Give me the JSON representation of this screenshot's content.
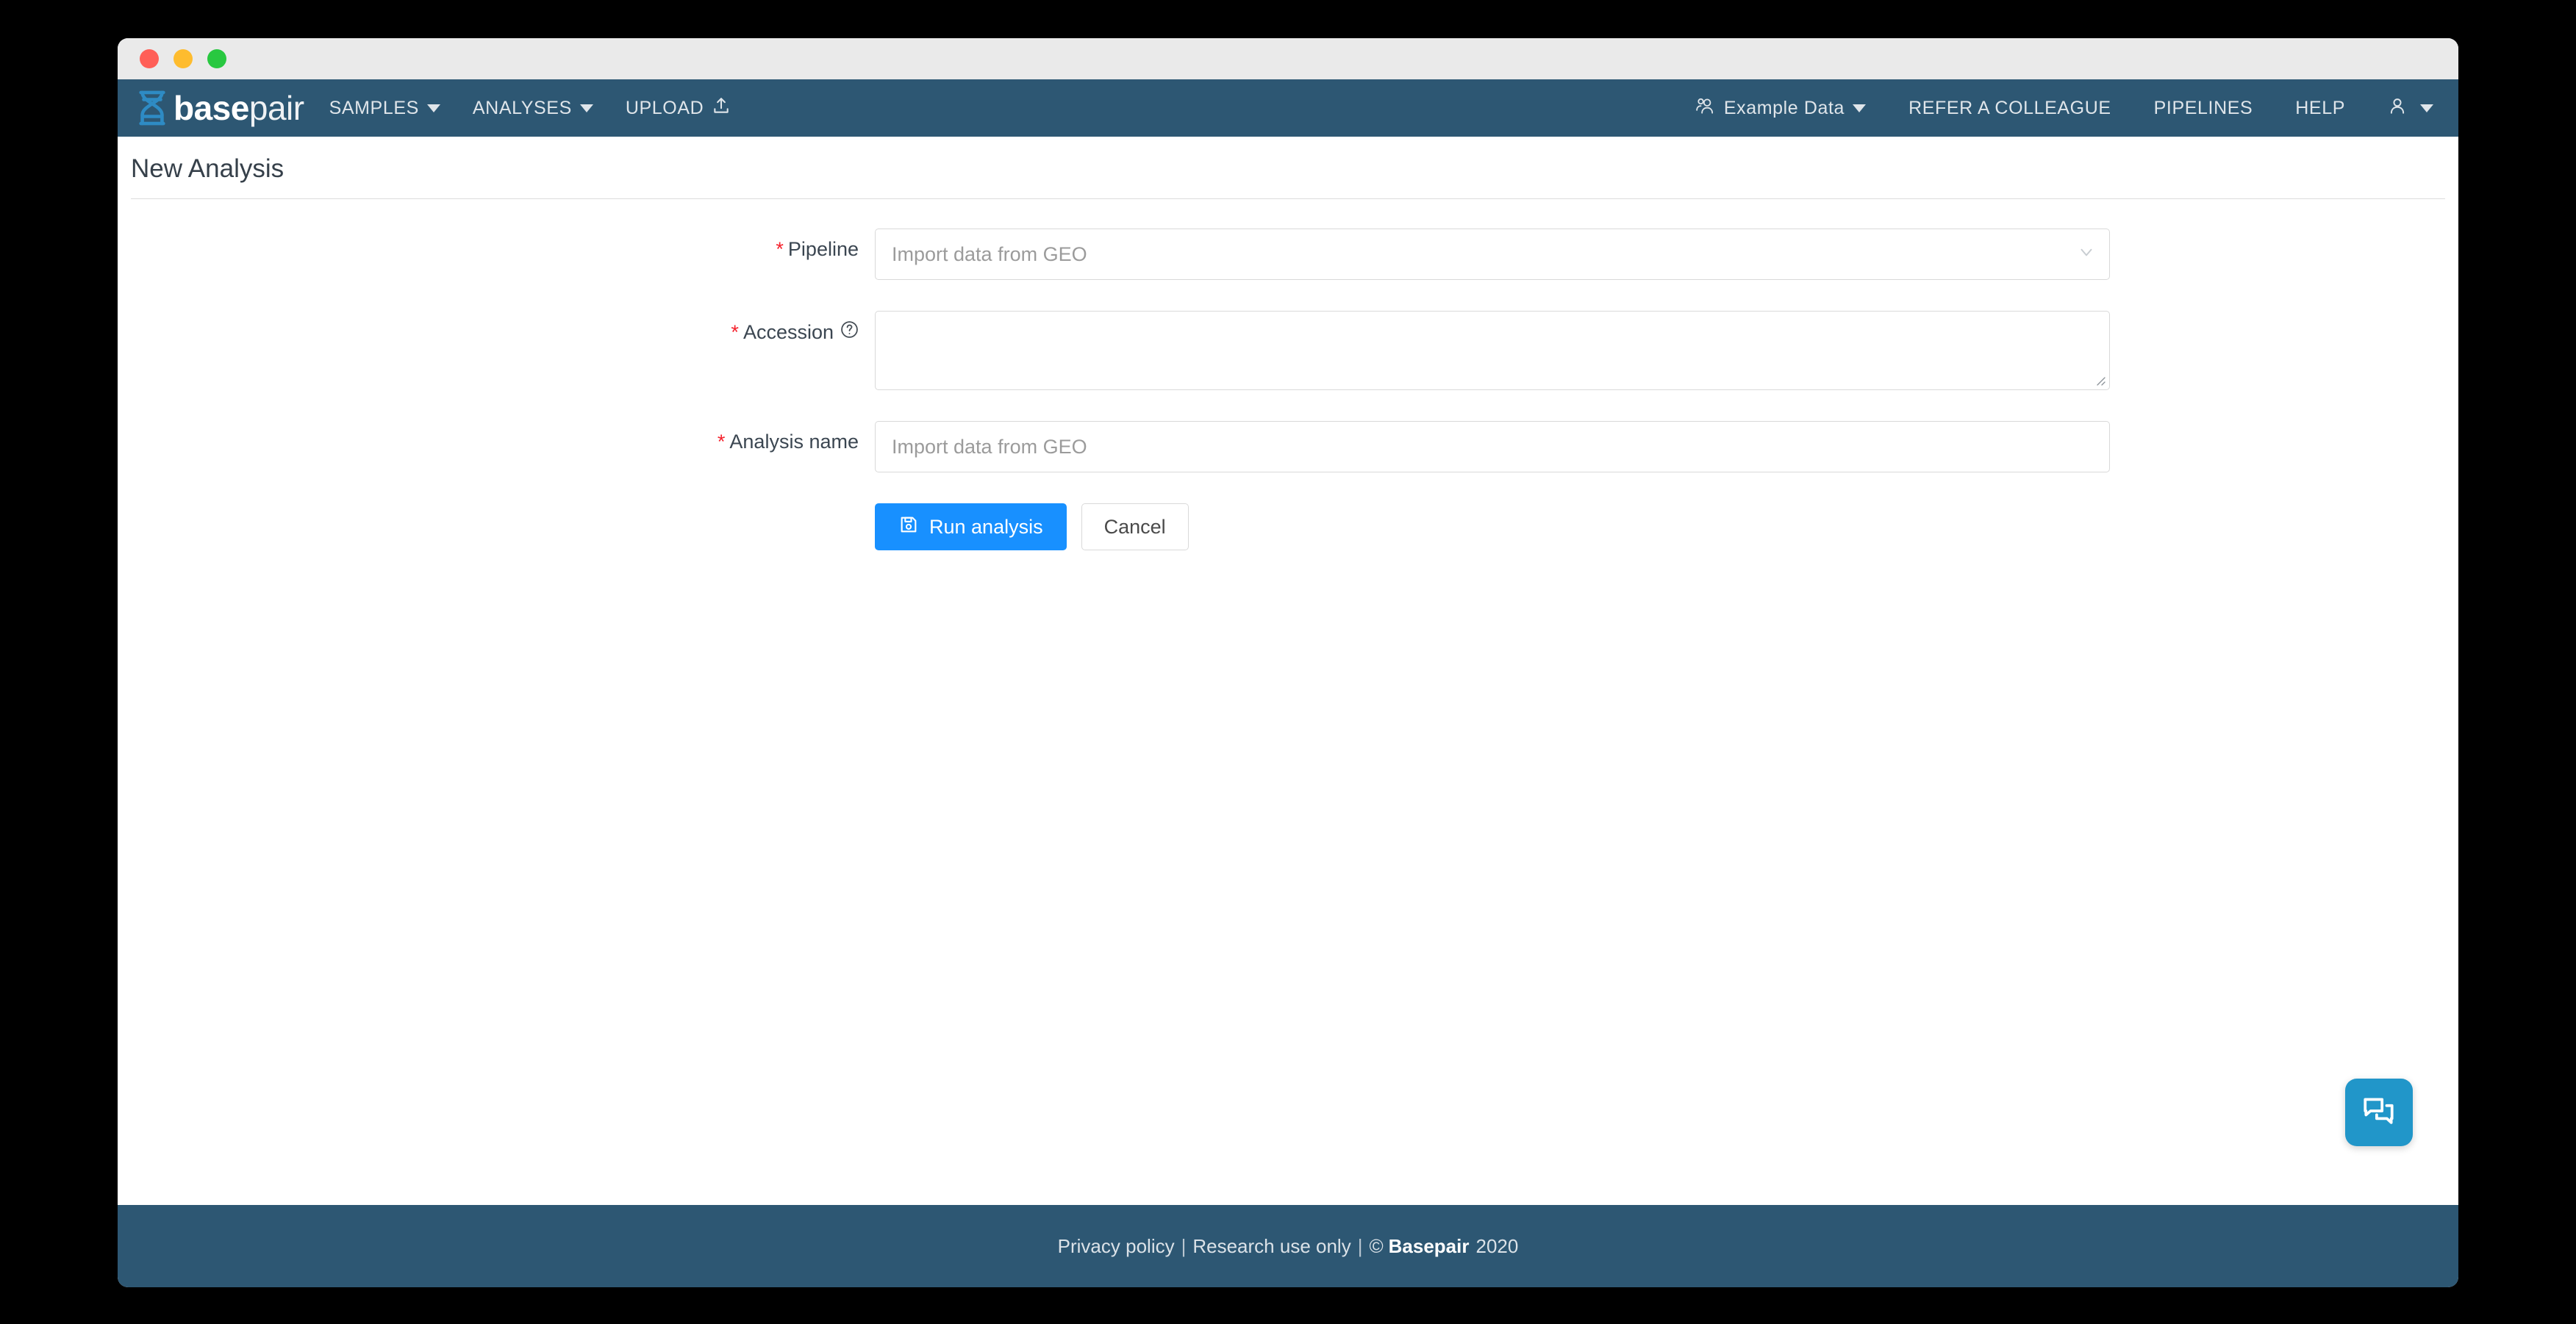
{
  "window": {
    "traffic_lights": [
      {
        "name": "close",
        "color": "#ff5f57"
      },
      {
        "name": "minimize",
        "color": "#febc2e"
      },
      {
        "name": "zoom",
        "color": "#28c840"
      }
    ]
  },
  "navbar": {
    "background": "#2d5773",
    "brand": {
      "bold": "base",
      "light": "pair",
      "icon": "dna-helix-icon",
      "icon_color": "#2e8bc4"
    },
    "left_items": [
      {
        "label": "SAMPLES",
        "has_caret": true
      },
      {
        "label": "ANALYSES",
        "has_caret": true
      },
      {
        "label": "UPLOAD",
        "has_caret": false,
        "icon": "upload-icon"
      }
    ],
    "right_items": [
      {
        "label": "Example Data",
        "has_caret": true,
        "icon": "people-icon"
      },
      {
        "label": "REFER A COLLEAGUE",
        "has_caret": false
      },
      {
        "label": "PIPELINES",
        "has_caret": false
      },
      {
        "label": "HELP",
        "has_caret": false
      }
    ],
    "account": {
      "icon": "user-icon",
      "has_caret": true
    }
  },
  "page": {
    "title": "New Analysis"
  },
  "form": {
    "pipeline": {
      "label": "Pipeline",
      "required_marker": "*",
      "value": "Import data from GEO",
      "chevron": "chevron-down-icon"
    },
    "accession": {
      "label": "Accession",
      "required_marker": "*",
      "help_icon": "question-circle-icon",
      "value": "",
      "placeholder": ""
    },
    "analysis_name": {
      "label": "Analysis name",
      "required_marker": "*",
      "value": "",
      "placeholder": "Import data from GEO"
    },
    "actions": {
      "run_label": "Run analysis",
      "run_icon": "save-icon",
      "run_color": "#1890ff",
      "cancel_label": "Cancel"
    }
  },
  "chat": {
    "icon": "chat-bubbles-icon",
    "color": "#2196c9"
  },
  "footer": {
    "privacy": "Privacy policy",
    "separator": "|",
    "usage": "Research use only",
    "copyright_symbol": "©",
    "company": "Basepair",
    "year": "2020"
  }
}
